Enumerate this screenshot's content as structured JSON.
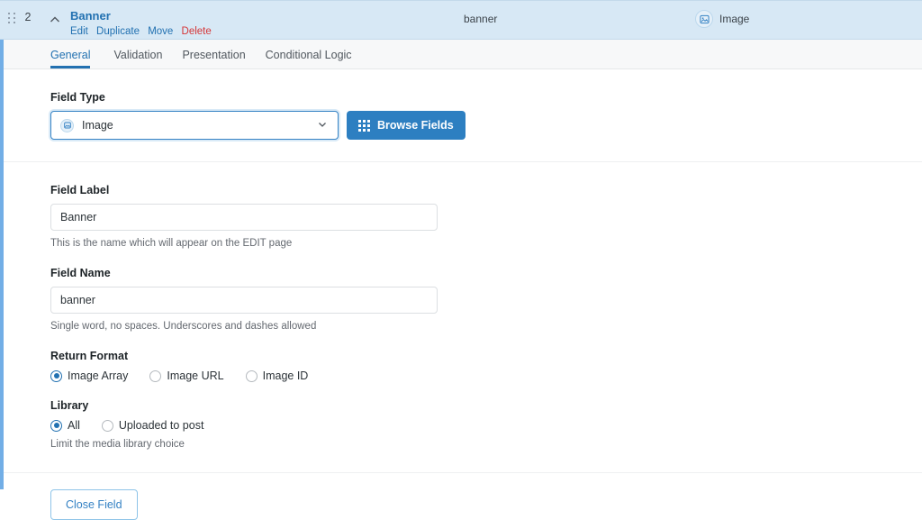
{
  "header": {
    "order_number": "2",
    "title": "Banner",
    "actions": [
      {
        "label": "Edit",
        "name": "edit"
      },
      {
        "label": "Duplicate",
        "name": "duplicate"
      },
      {
        "label": "Move",
        "name": "move"
      },
      {
        "label": "Delete",
        "name": "delete"
      }
    ],
    "field_name": "banner",
    "field_type_label": "Image",
    "type_icon": "image-icon",
    "drag_handle_icon": "drag-handle-icon",
    "collapse_icon": "chevron-up-icon",
    "background_color": "#d7e8f5"
  },
  "tabs": [
    {
      "label": "General",
      "active": true
    },
    {
      "label": "Validation",
      "active": false
    },
    {
      "label": "Presentation",
      "active": false
    },
    {
      "label": "Conditional Logic",
      "active": false
    }
  ],
  "settings": {
    "field_type": {
      "label": "Field Type",
      "value": "Image",
      "icon": "image-icon",
      "dropdown_icon": "chevron-down-icon",
      "browse_button": {
        "label": "Browse Fields",
        "icon": "grid-dots-icon"
      }
    },
    "field_label": {
      "label": "Field Label",
      "value": "Banner",
      "hint": "This is the name which will appear on the EDIT page"
    },
    "field_name": {
      "label": "Field Name",
      "value": "banner",
      "hint": "Single word, no spaces. Underscores and dashes allowed"
    },
    "return_format": {
      "label": "Return Format",
      "options": [
        {
          "label": "Image Array",
          "checked": true
        },
        {
          "label": "Image URL",
          "checked": false
        },
        {
          "label": "Image ID",
          "checked": false
        }
      ]
    },
    "library": {
      "label": "Library",
      "options": [
        {
          "label": "All",
          "checked": true
        },
        {
          "label": "Uploaded to post",
          "checked": false
        }
      ],
      "hint": "Limit the media library choice"
    }
  },
  "footer": {
    "close_label": "Close Field"
  },
  "colors": {
    "accent": "#2271b1",
    "header_bg": "#d7e8f5",
    "primary_button": "#2d7fc1",
    "danger": "#d63638",
    "left_bar": "#72aee6"
  }
}
